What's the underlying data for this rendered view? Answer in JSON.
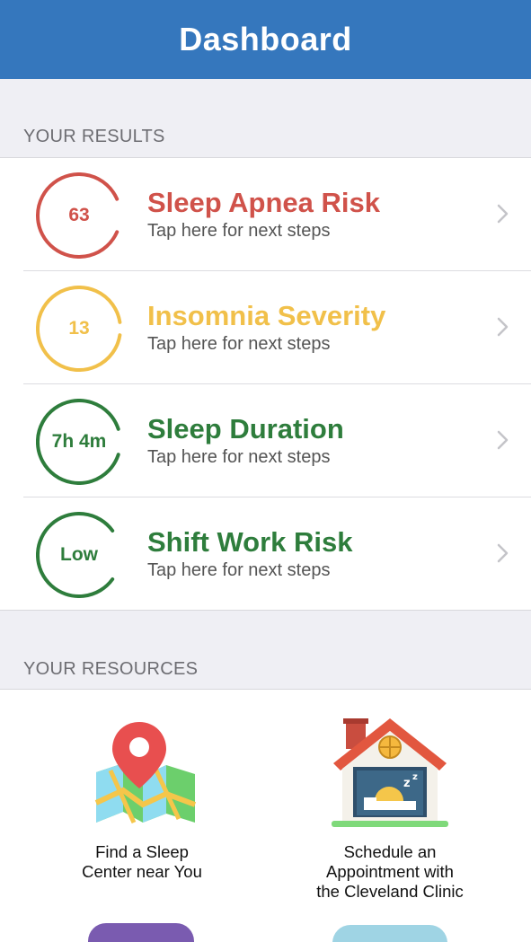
{
  "header": {
    "title": "Dashboard"
  },
  "results_section": {
    "heading": "YOUR RESULTS"
  },
  "results": [
    {
      "value": "63",
      "title": "Sleep Apnea Risk",
      "subtitle": "Tap here for next steps",
      "color": "#d0524a",
      "level": 0.37
    },
    {
      "value": "13",
      "title": "Insomnia Severity",
      "subtitle": "Tap here for next steps",
      "color": "#f1c04a",
      "level": 0.45
    },
    {
      "value": "7h 4m",
      "title": "Sleep Duration",
      "subtitle": "Tap here for next steps",
      "color": "#2e7d3c",
      "level": 0.4
    },
    {
      "value": "Low",
      "title": "Shift Work Risk",
      "subtitle": "Tap here for next steps",
      "color": "#2e7d3c",
      "level": 0.3
    }
  ],
  "resources_section": {
    "heading": "YOUR RESOURCES"
  },
  "resources": [
    {
      "label": "Find a Sleep\nCenter near You",
      "icon": "map-pin-icon"
    },
    {
      "label": "Schedule an\nAppointment with\nthe Cleveland Clinic",
      "icon": "house-sleep-icon"
    }
  ]
}
